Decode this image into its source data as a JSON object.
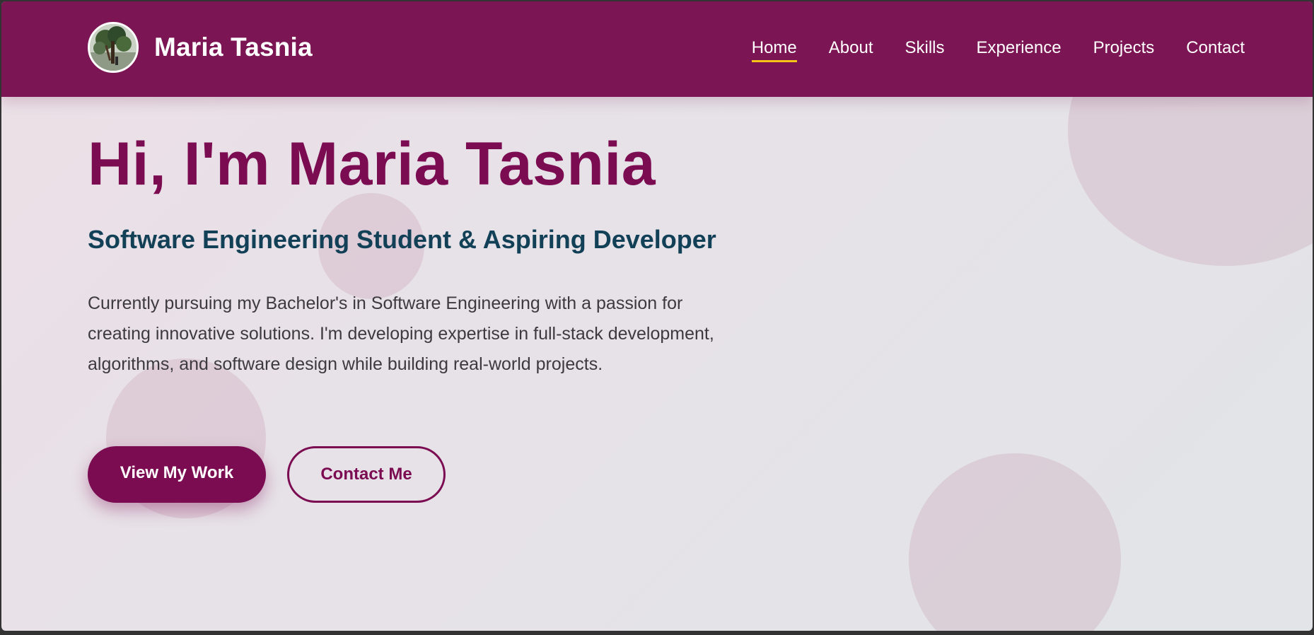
{
  "brand": {
    "name": "Maria Tasnia",
    "avatar_icon": "profile-photo-tree"
  },
  "nav": {
    "items": [
      {
        "label": "Home",
        "active": true
      },
      {
        "label": "About",
        "active": false
      },
      {
        "label": "Skills",
        "active": false
      },
      {
        "label": "Experience",
        "active": false
      },
      {
        "label": "Projects",
        "active": false
      },
      {
        "label": "Contact",
        "active": false
      }
    ]
  },
  "hero": {
    "title": "Hi, I'm Maria Tasnia",
    "subtitle": "Software Engineering Student & Aspiring Developer",
    "description": "Currently pursuing my Bachelor's in Software Engineering with a passion for creating innovative solutions. I'm developing expertise in full-stack development, algorithms, and software design while building real-world projects.",
    "primary_button": "View My Work",
    "secondary_button": "Contact Me"
  },
  "colors": {
    "brand_primary": "#7b1553",
    "heading": "#7b0c52",
    "subtitle": "#124057",
    "active_underline": "#f5c518"
  }
}
